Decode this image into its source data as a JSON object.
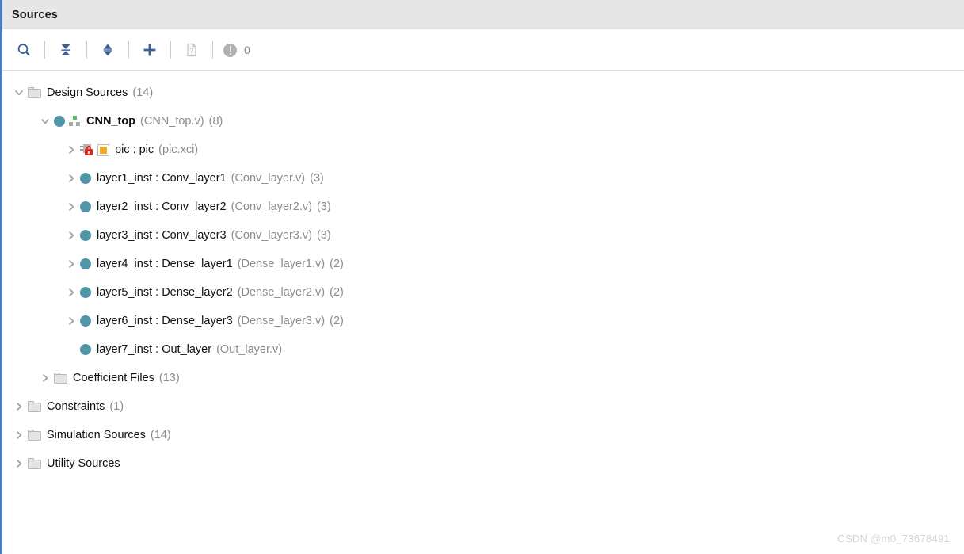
{
  "panel": {
    "title": "Sources"
  },
  "toolbar": {
    "buttons": [
      {
        "name": "search-icon",
        "label": "Search"
      },
      {
        "name": "collapse-all-icon",
        "label": "Collapse All"
      },
      {
        "name": "expand-collapse-icon",
        "label": "Expand/Collapse"
      },
      {
        "name": "add-sources-icon",
        "label": "Add Sources"
      },
      {
        "name": "report-icon",
        "label": "Report"
      }
    ],
    "status": {
      "icon": "warning-circle-icon",
      "count": "0"
    }
  },
  "colors": {
    "accent_bar": "#4a7ebb",
    "header_bg": "#e6e6e6",
    "toolbar_icon": "#3c5f92",
    "module_circle": "#4f97a8",
    "hierarchy_green": "#5cb85c",
    "lock_red": "#e02b20",
    "ip_square_orange": "#f5a623",
    "muted_text": "#8c8c8c"
  },
  "tree": [
    {
      "id": "design-sources",
      "level": 0,
      "expander": "expanded",
      "icon": "folder-icon",
      "name": "Design Sources",
      "file": "",
      "count": "(14)",
      "bold": false
    },
    {
      "id": "cnn-top",
      "level": 1,
      "expander": "expanded",
      "icon": "module-hierarchy-icon",
      "name": "CNN_top",
      "file": "(CNN_top.v)",
      "count": "(8)",
      "bold": true
    },
    {
      "id": "pic",
      "level": 2,
      "expander": "collapsed",
      "icon": "ip-locked-icon",
      "name": "pic : pic",
      "file": "(pic.xci)",
      "count": "",
      "bold": false
    },
    {
      "id": "layer1-inst",
      "level": 2,
      "expander": "collapsed",
      "icon": "module-icon",
      "name": "layer1_inst : Conv_layer1",
      "file": "(Conv_layer.v)",
      "count": "(3)",
      "bold": false
    },
    {
      "id": "layer2-inst",
      "level": 2,
      "expander": "collapsed",
      "icon": "module-icon",
      "name": "layer2_inst : Conv_layer2",
      "file": "(Conv_layer2.v)",
      "count": "(3)",
      "bold": false
    },
    {
      "id": "layer3-inst",
      "level": 2,
      "expander": "collapsed",
      "icon": "module-icon",
      "name": "layer3_inst : Conv_layer3",
      "file": "(Conv_layer3.v)",
      "count": "(3)",
      "bold": false
    },
    {
      "id": "layer4-inst",
      "level": 2,
      "expander": "collapsed",
      "icon": "module-icon",
      "name": "layer4_inst : Dense_layer1",
      "file": "(Dense_layer1.v)",
      "count": "(2)",
      "bold": false
    },
    {
      "id": "layer5-inst",
      "level": 2,
      "expander": "collapsed",
      "icon": "module-icon",
      "name": "layer5_inst : Dense_layer2",
      "file": "(Dense_layer2.v)",
      "count": "(2)",
      "bold": false
    },
    {
      "id": "layer6-inst",
      "level": 2,
      "expander": "collapsed",
      "icon": "module-icon",
      "name": "layer6_inst : Dense_layer3",
      "file": "(Dense_layer3.v)",
      "count": "(2)",
      "bold": false
    },
    {
      "id": "layer7-inst",
      "level": 2,
      "expander": "none",
      "icon": "module-icon",
      "name": "layer7_inst : Out_layer",
      "file": "(Out_layer.v)",
      "count": "",
      "bold": false
    },
    {
      "id": "coefficient-files",
      "level": 1,
      "expander": "collapsed",
      "icon": "folder-icon",
      "name": "Coefficient Files",
      "file": "",
      "count": "(13)",
      "bold": false
    },
    {
      "id": "constraints",
      "level": 0,
      "expander": "collapsed",
      "icon": "folder-icon",
      "name": "Constraints",
      "file": "",
      "count": "(1)",
      "bold": false
    },
    {
      "id": "simulation-sources",
      "level": 0,
      "expander": "collapsed",
      "icon": "folder-icon",
      "name": "Simulation Sources",
      "file": "",
      "count": "(14)",
      "bold": false
    },
    {
      "id": "utility-sources",
      "level": 0,
      "expander": "collapsed",
      "icon": "folder-icon",
      "name": "Utility Sources",
      "file": "",
      "count": "",
      "bold": false
    }
  ],
  "watermark": "CSDN @m0_73678491"
}
